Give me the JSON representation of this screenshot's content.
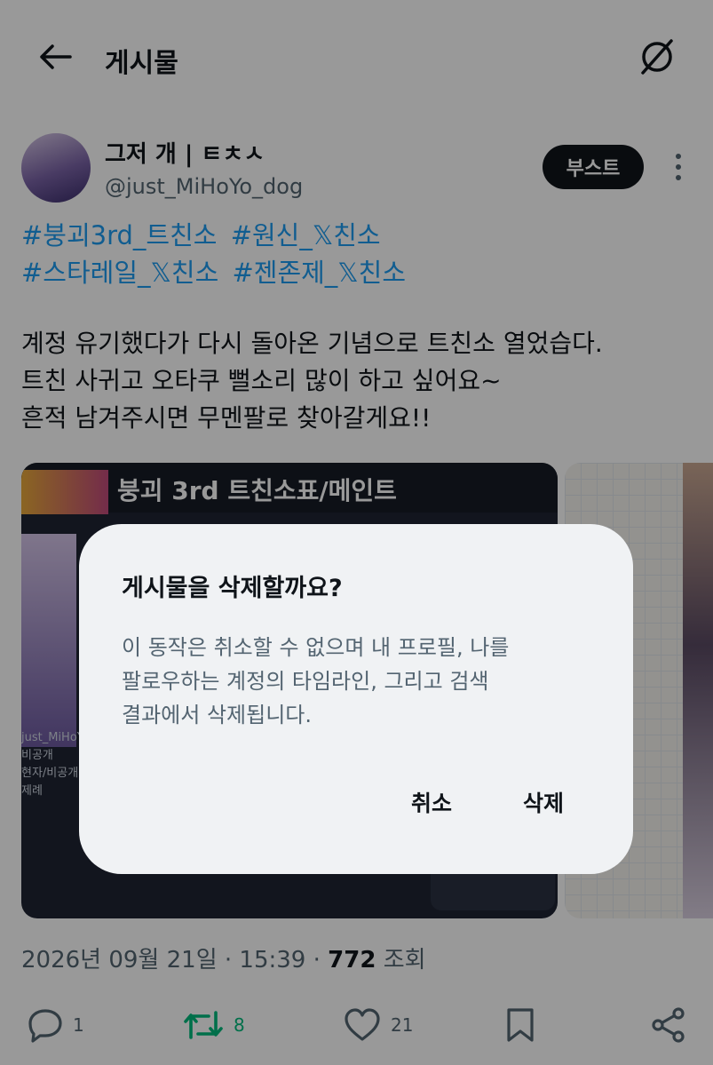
{
  "header": {
    "title": "게시물",
    "back_icon": "arrow-left-icon",
    "grok_icon": "grok-icon"
  },
  "author": {
    "name": "그저 개 | ㅌㅊㅅ",
    "handle": "@just_MiHoYo_dog",
    "boost_label": "부스트"
  },
  "post": {
    "hashtags": [
      "#붕괴3rd_트친소",
      "#원신_𝕏친소",
      "#스타레일_𝕏친소",
      "#젠존제_𝕏친소"
    ],
    "lines": [
      "계정 유기했다가 다시 돌아온 기념으로 트친소 열었습다.",
      "트친 사귀고 오타쿠 뻘소리 많이 하고 싶어요~",
      "흔적 남겨주시면 무멘팔로 찾아갈게요!!"
    ]
  },
  "media": {
    "banner_text": "붕괴 3rd 트친소표/메인트",
    "side_labels": [
      "just_MiHoY",
      "비공개",
      "현자/비공개",
      "제례"
    ]
  },
  "meta": {
    "date_time": "2026년 09월 21일 · 15:39 · ",
    "views_count": "772",
    "views_label": " 조회"
  },
  "actions": {
    "reply_count": "1",
    "retweet_count": "8",
    "like_count": "21"
  },
  "dialog": {
    "title": "게시물을 삭제할까요?",
    "message_lines": [
      "이 동작은 취소할 수 없으며 내 프로필, 나를",
      "팔로우하는 계정의 타임라인, 그리고 검색",
      "결과에서 삭제됩니다."
    ],
    "cancel_label": "취소",
    "delete_label": "삭제"
  },
  "colors": {
    "accent": "#1d9bf0",
    "retweet": "#00ba7c",
    "secondary_text": "#536471",
    "dialog_bg": "#f0f2f4"
  }
}
